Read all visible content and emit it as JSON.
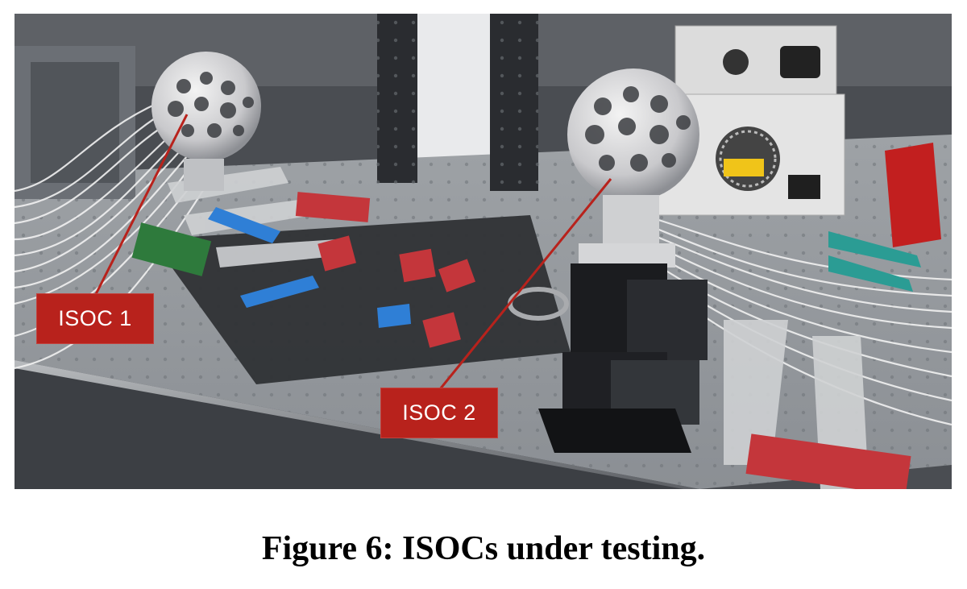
{
  "figure": {
    "callouts": [
      {
        "label": "ISOC 1"
      },
      {
        "label": "ISOC 2"
      }
    ],
    "caption": "Figure 6: ISOCs under testing."
  }
}
